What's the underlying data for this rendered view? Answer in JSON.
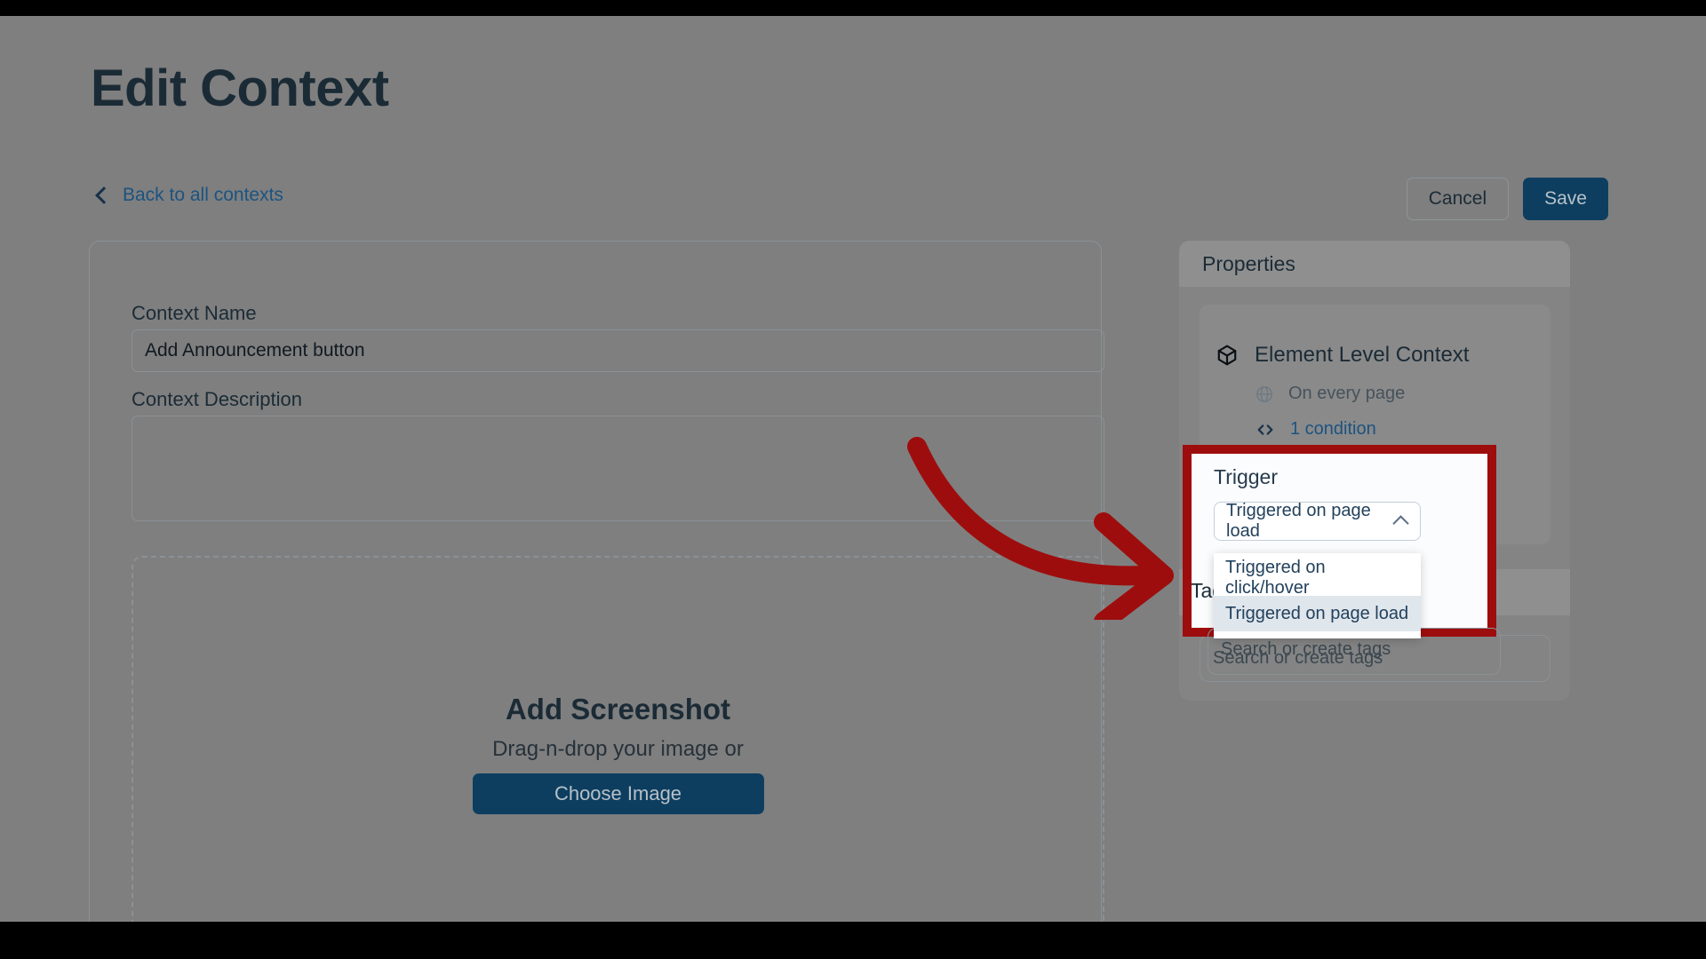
{
  "header": {
    "title": "Edit Context",
    "back_link": "Back to all contexts",
    "back_icon": "chevron-left-icon",
    "cancel_label": "Cancel",
    "save_label": "Save"
  },
  "form": {
    "name_label": "Context Name",
    "name_value": "Add Announcement button",
    "name_placeholder": "Context Name",
    "description_label": "Context Description",
    "description_value": "",
    "description_placeholder": ""
  },
  "dropzone": {
    "title": "Add Screenshot",
    "subtitle": "Drag-n-drop your image or",
    "button_label": "Choose Image"
  },
  "properties": {
    "header": "Properties",
    "context_level": "Element Level Context",
    "context_level_icon": "cube-icon",
    "scope": "On every page",
    "scope_icon": "globe-icon",
    "condition": "1 condition",
    "condition_icon": "code-brackets-icon"
  },
  "tags": {
    "header": "Tags",
    "header_clipped": "Ta",
    "placeholder": "Search or create tags",
    "value": ""
  },
  "trigger": {
    "label": "Trigger",
    "selected": "Triggered on page load",
    "caret_icon": "chevron-up-icon",
    "options": [
      {
        "label": "Triggered on click/hover",
        "selected": false
      },
      {
        "label": "Triggered on page load",
        "selected": true
      }
    ]
  },
  "annotation": {
    "highlight_color": "#9e0d0d",
    "arrow_color": "#9e0d0d",
    "arrow_icon": "curved-arrow-right-icon"
  },
  "colors": {
    "accent": "#0d3e60",
    "link": "#1c5380",
    "text": "#1b2b36",
    "overlay": "#7f7f7f"
  }
}
